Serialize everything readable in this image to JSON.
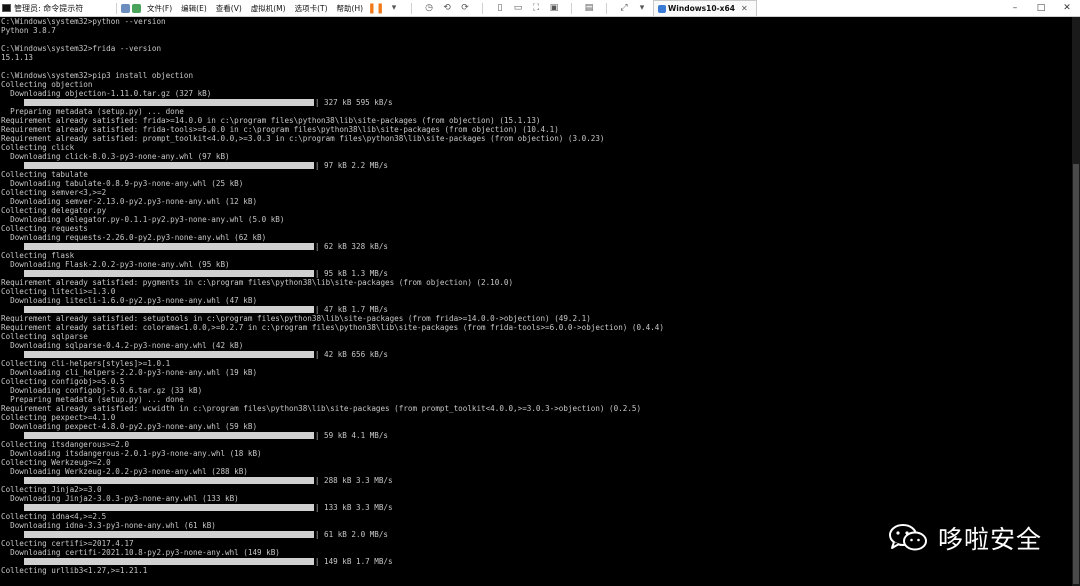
{
  "titlebar": {
    "window_title": "管理员: 命令提示符"
  },
  "menu": [
    "文件(F)",
    "编辑(E)",
    "查看(V)",
    "虚拟机(M)",
    "选项卡(T)",
    "帮助(H)"
  ],
  "vm_tab": {
    "label": "Windows10-x64"
  },
  "window_controls": [
    "–",
    "□",
    "✕"
  ],
  "watermark": {
    "text": "哆啦安全"
  },
  "colors": {
    "terminal_bg": "#000000",
    "terminal_fg": "#c8c8c8",
    "pause_orange": "#f07818"
  },
  "console": {
    "lines": [
      {
        "text": "C:\\Windows\\system32>python --version"
      },
      {
        "text": "Python 3.8.7"
      },
      {
        "text": ""
      },
      {
        "text": "C:\\Windows\\system32>frida --version"
      },
      {
        "text": "15.1.13"
      },
      {
        "text": ""
      },
      {
        "text": "C:\\Windows\\system32>pip3 install objection"
      },
      {
        "text": "Collecting objection"
      },
      {
        "text": "  Downloading objection-1.11.0.tar.gz (327 kB)"
      },
      {
        "progress": 1,
        "text": "327 kB 595 kB/s"
      },
      {
        "text": "  Preparing metadata (setup.py) ... done"
      },
      {
        "text": "Requirement already satisfied: frida>=14.0.0 in c:\\program files\\python38\\lib\\site-packages (from objection) (15.1.13)"
      },
      {
        "text": "Requirement already satisfied: frida-tools>=6.0.0 in c:\\program files\\python38\\lib\\site-packages (from objection) (10.4.1)"
      },
      {
        "text": "Requirement already satisfied: prompt_toolkit<4.0.0,>=3.0.3 in c:\\program files\\python38\\lib\\site-packages (from objection) (3.0.23)"
      },
      {
        "text": "Collecting click"
      },
      {
        "text": "  Downloading click-8.0.3-py3-none-any.whl (97 kB)"
      },
      {
        "progress": 1,
        "text": "97 kB 2.2 MB/s"
      },
      {
        "text": "Collecting tabulate"
      },
      {
        "text": "  Downloading tabulate-0.8.9-py3-none-any.whl (25 kB)"
      },
      {
        "text": "Collecting semver<3,>=2"
      },
      {
        "text": "  Downloading semver-2.13.0-py2.py3-none-any.whl (12 kB)"
      },
      {
        "text": "Collecting delegator.py"
      },
      {
        "text": "  Downloading delegator.py-0.1.1-py2.py3-none-any.whl (5.0 kB)"
      },
      {
        "text": "Collecting requests"
      },
      {
        "text": "  Downloading requests-2.26.0-py2.py3-none-any.whl (62 kB)"
      },
      {
        "progress": 1,
        "text": "62 kB 328 kB/s"
      },
      {
        "text": "Collecting flask"
      },
      {
        "text": "  Downloading Flask-2.0.2-py3-none-any.whl (95 kB)"
      },
      {
        "progress": 1,
        "text": "95 kB 1.3 MB/s"
      },
      {
        "text": "Requirement already satisfied: pygments in c:\\program files\\python38\\lib\\site-packages (from objection) (2.10.0)"
      },
      {
        "text": "Collecting litecli>=1.3.0"
      },
      {
        "text": "  Downloading litecli-1.6.0-py2.py3-none-any.whl (47 kB)"
      },
      {
        "progress": 1,
        "text": "47 kB 1.7 MB/s"
      },
      {
        "text": "Requirement already satisfied: setuptools in c:\\program files\\python38\\lib\\site-packages (from frida>=14.0.0->objection) (49.2.1)"
      },
      {
        "text": "Requirement already satisfied: colorama<1.0.0,>=0.2.7 in c:\\program files\\python38\\lib\\site-packages (from frida-tools>=6.0.0->objection) (0.4.4)"
      },
      {
        "text": "Collecting sqlparse"
      },
      {
        "text": "  Downloading sqlparse-0.4.2-py3-none-any.whl (42 kB)"
      },
      {
        "progress": 1,
        "text": "42 kB 656 kB/s"
      },
      {
        "text": "Collecting cli-helpers[styles]>=1.0.1"
      },
      {
        "text": "  Downloading cli_helpers-2.2.0-py3-none-any.whl (19 kB)"
      },
      {
        "text": "Collecting configobj>=5.0.5"
      },
      {
        "text": "  Downloading configobj-5.0.6.tar.gz (33 kB)"
      },
      {
        "text": "  Preparing metadata (setup.py) ... done"
      },
      {
        "text": "Requirement already satisfied: wcwidth in c:\\program files\\python38\\lib\\site-packages (from prompt_toolkit<4.0.0,>=3.0.3->objection) (0.2.5)"
      },
      {
        "text": "Collecting pexpect>=4.1.0"
      },
      {
        "text": "  Downloading pexpect-4.8.0-py2.py3-none-any.whl (59 kB)"
      },
      {
        "progress": 1,
        "text": "59 kB 4.1 MB/s"
      },
      {
        "text": "Collecting itsdangerous>=2.0"
      },
      {
        "text": "  Downloading itsdangerous-2.0.1-py3-none-any.whl (18 kB)"
      },
      {
        "text": "Collecting Werkzeug>=2.0"
      },
      {
        "text": "  Downloading Werkzeug-2.0.2-py3-none-any.whl (288 kB)"
      },
      {
        "progress": 1,
        "text": "288 kB 3.3 MB/s"
      },
      {
        "text": "Collecting Jinja2>=3.0"
      },
      {
        "text": "  Downloading Jinja2-3.0.3-py3-none-any.whl (133 kB)"
      },
      {
        "progress": 1,
        "text": "133 kB 3.3 MB/s"
      },
      {
        "text": "Collecting idna<4,>=2.5"
      },
      {
        "text": "  Downloading idna-3.3-py3-none-any.whl (61 kB)"
      },
      {
        "progress": 1,
        "text": "61 kB 2.0 MB/s"
      },
      {
        "text": "Collecting certifi>=2017.4.17"
      },
      {
        "text": "  Downloading certifi-2021.10.8-py2.py3-none-any.whl (149 kB)"
      },
      {
        "progress": 1,
        "text": "149 kB 1.7 MB/s"
      },
      {
        "text": "Collecting urllib3<1.27,>=1.21.1"
      }
    ]
  }
}
